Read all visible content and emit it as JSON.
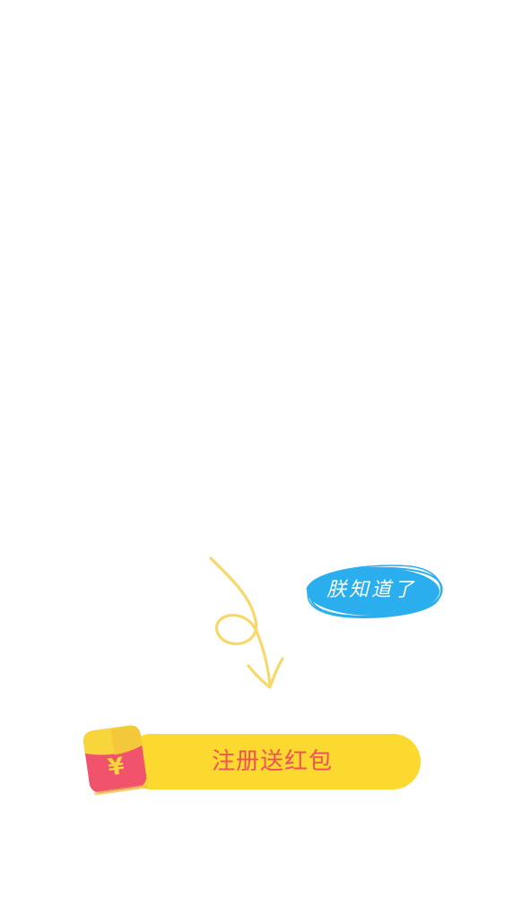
{
  "guide": {
    "dismiss_label": "朕知道了",
    "dismiss_color": "#2aaeed",
    "arrow_icon": "hand-drawn-arrow-icon",
    "arrow_color": "#f7d86a"
  },
  "promo": {
    "register_label": "注册送红包",
    "button_color": "#fbd92f",
    "text_color": "#f1515a",
    "envelope_icon": "red-envelope-icon",
    "envelope_color": "#f2536c",
    "envelope_flap_color": "#f8d53a",
    "currency_symbol": "¥"
  }
}
